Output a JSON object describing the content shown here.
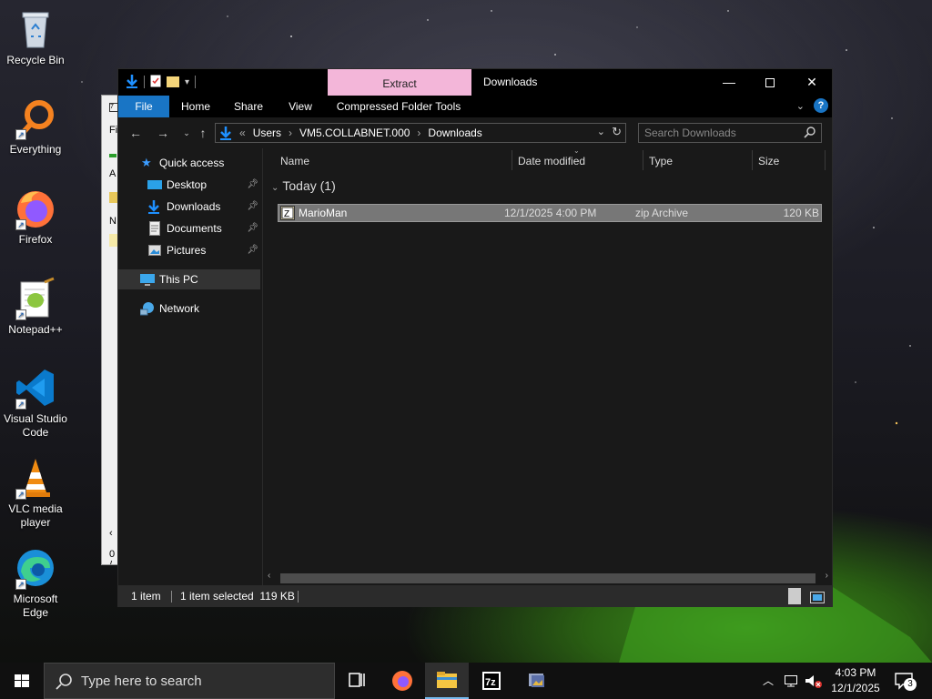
{
  "desktop_icons": [
    {
      "label": "Recycle Bin",
      "icon": "recycle-bin-icon"
    },
    {
      "label": "Everything",
      "icon": "search-magnifier-icon"
    },
    {
      "label": "Firefox",
      "icon": "firefox-icon"
    },
    {
      "label": "Notepad++",
      "icon": "notepad-plus-plus-icon"
    },
    {
      "label": "Visual Studio Code",
      "icon": "vscode-icon"
    },
    {
      "label": "VLC media player",
      "icon": "vlc-cone-icon"
    },
    {
      "label": "Microsoft Edge",
      "icon": "edge-icon"
    }
  ],
  "bg_window": {
    "fragments": [
      "Fi",
      "A",
      "N",
      "0 /"
    ]
  },
  "explorer": {
    "context_tab": "Extract",
    "title": "Downloads",
    "ribbon_tabs": [
      "File",
      "Home",
      "Share",
      "View",
      "Compressed Folder Tools"
    ],
    "address": {
      "crumbs": [
        "Users",
        "VM5.COLLABNET.000",
        "Downloads"
      ],
      "overflow": "«"
    },
    "search": {
      "placeholder": "Search Downloads"
    },
    "nav": {
      "quick_access": "Quick access",
      "items": [
        {
          "label": "Desktop",
          "pinned": true
        },
        {
          "label": "Downloads",
          "pinned": true
        },
        {
          "label": "Documents",
          "pinned": true
        },
        {
          "label": "Pictures",
          "pinned": true
        }
      ],
      "this_pc": "This PC",
      "network": "Network"
    },
    "columns": [
      "Name",
      "Date modified",
      "Type",
      "Size"
    ],
    "group_label": "Today (1)",
    "files": [
      {
        "name": "MarioMan",
        "date": "12/1/2025 4:00 PM",
        "type": "zip Archive",
        "size": "120 KB",
        "selected": true
      }
    ],
    "status": {
      "count": "1 item",
      "selected": "1 item selected  119 KB"
    }
  },
  "taskbar": {
    "search_placeholder": "Type here to search",
    "apps": [
      "task-view",
      "firefox",
      "file-explorer",
      "7zip",
      "photos"
    ],
    "clock": {
      "time": "4:03 PM",
      "date": "12/1/2025"
    },
    "notifications": "3"
  },
  "colors": {
    "accent": "#1975c5",
    "extract_tab": "#f3b6d9",
    "selection": "#777777"
  }
}
